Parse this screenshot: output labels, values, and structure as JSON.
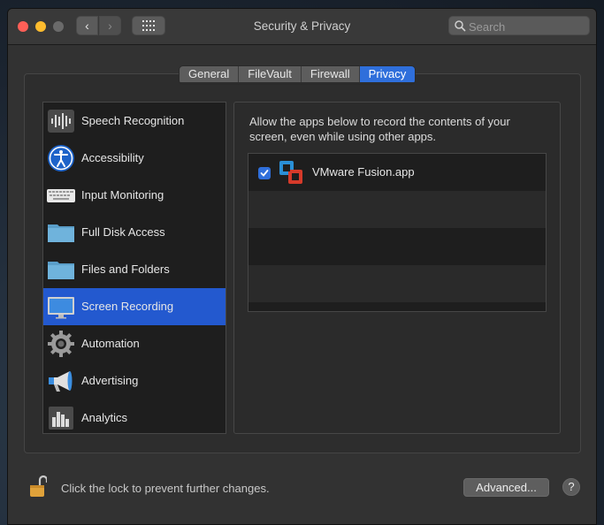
{
  "window": {
    "title": "Security & Privacy",
    "search_placeholder": "Search"
  },
  "tabs": [
    {
      "label": "General",
      "active": false
    },
    {
      "label": "FileVault",
      "active": false
    },
    {
      "label": "Firewall",
      "active": false
    },
    {
      "label": "Privacy",
      "active": true
    }
  ],
  "sidebar": {
    "items": [
      {
        "label": "Speech Recognition",
        "icon": "speech-waveform-icon"
      },
      {
        "label": "Accessibility",
        "icon": "accessibility-icon"
      },
      {
        "label": "Input Monitoring",
        "icon": "keyboard-icon"
      },
      {
        "label": "Full Disk Access",
        "icon": "folder-icon"
      },
      {
        "label": "Files and Folders",
        "icon": "folder-icon"
      },
      {
        "label": "Screen Recording",
        "icon": "display-icon",
        "selected": true
      },
      {
        "label": "Automation",
        "icon": "gear-icon"
      },
      {
        "label": "Advertising",
        "icon": "megaphone-icon"
      },
      {
        "label": "Analytics",
        "icon": "bar-chart-icon"
      }
    ]
  },
  "panel": {
    "description": "Allow the apps below to record the contents of your screen, even while using other apps.",
    "apps": [
      {
        "name": "VMware Fusion.app",
        "checked": true,
        "icon": "vmware-fusion-icon"
      }
    ]
  },
  "footer": {
    "lock_text": "Click the lock to prevent further changes.",
    "advanced_label": "Advanced...",
    "help_label": "?"
  },
  "colors": {
    "accent": "#2f6fdb",
    "selection": "#2359cf"
  }
}
